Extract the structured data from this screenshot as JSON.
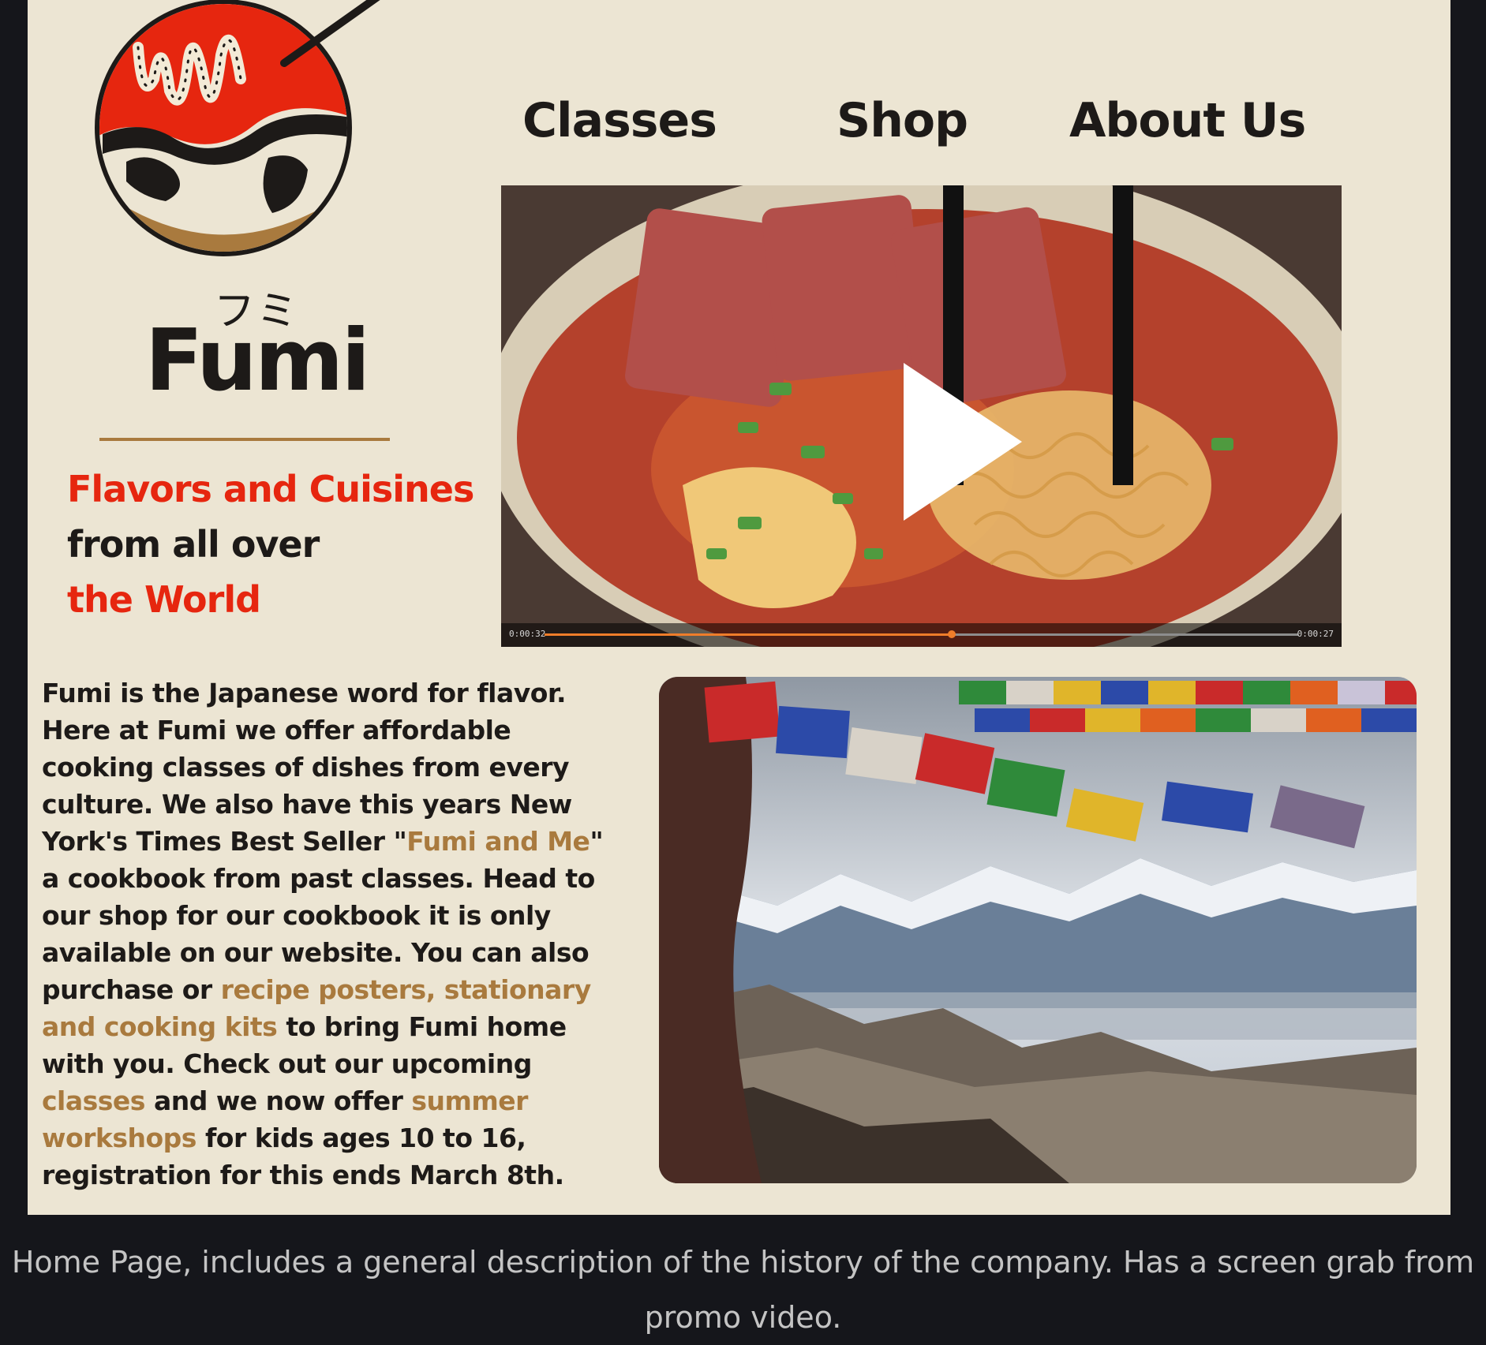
{
  "brand": {
    "kana": "フミ",
    "name": "Fumi"
  },
  "tagline": {
    "line1": "Flavors and Cuisines",
    "line2": "from all over",
    "line3": "the World"
  },
  "nav": {
    "classes": "Classes",
    "shop": "Shop",
    "about": "About Us"
  },
  "video": {
    "elapsed": "0:00:32",
    "remaining": "0:00:27",
    "progress_fraction": 0.54
  },
  "copy": {
    "p1": "Fumi is the Japanese word for flavor. Here at Fumi we offer affordable cooking classes of dishes from every culture. We also have this years New York's Times Best Seller \"",
    "link_book": "Fumi and Me",
    "p2": "\" a cookbook from past classes. Head to our shop for our cookbook it is only available on our website. You can also purchase or ",
    "link_products": "recipe posters, stationary and cooking kits",
    "p3": " to bring Fumi home with you. Check out our upcoming ",
    "link_classes": "classes",
    "p4": " and we now offer ",
    "link_workshops": "summer workshops",
    "p5": " for kids ages 10 to 16, registration for this ends March 8th."
  },
  "caption": {
    "line1": "Home Page, includes a general description of the history of the company. Has a screen grab from",
    "line2": "promo video."
  },
  "colors": {
    "page_bg": "#15161b",
    "card_bg": "#ece5d3",
    "accent_red": "#e6260f",
    "accent_gold": "#a97a3e",
    "text_dark": "#1d1a18"
  }
}
